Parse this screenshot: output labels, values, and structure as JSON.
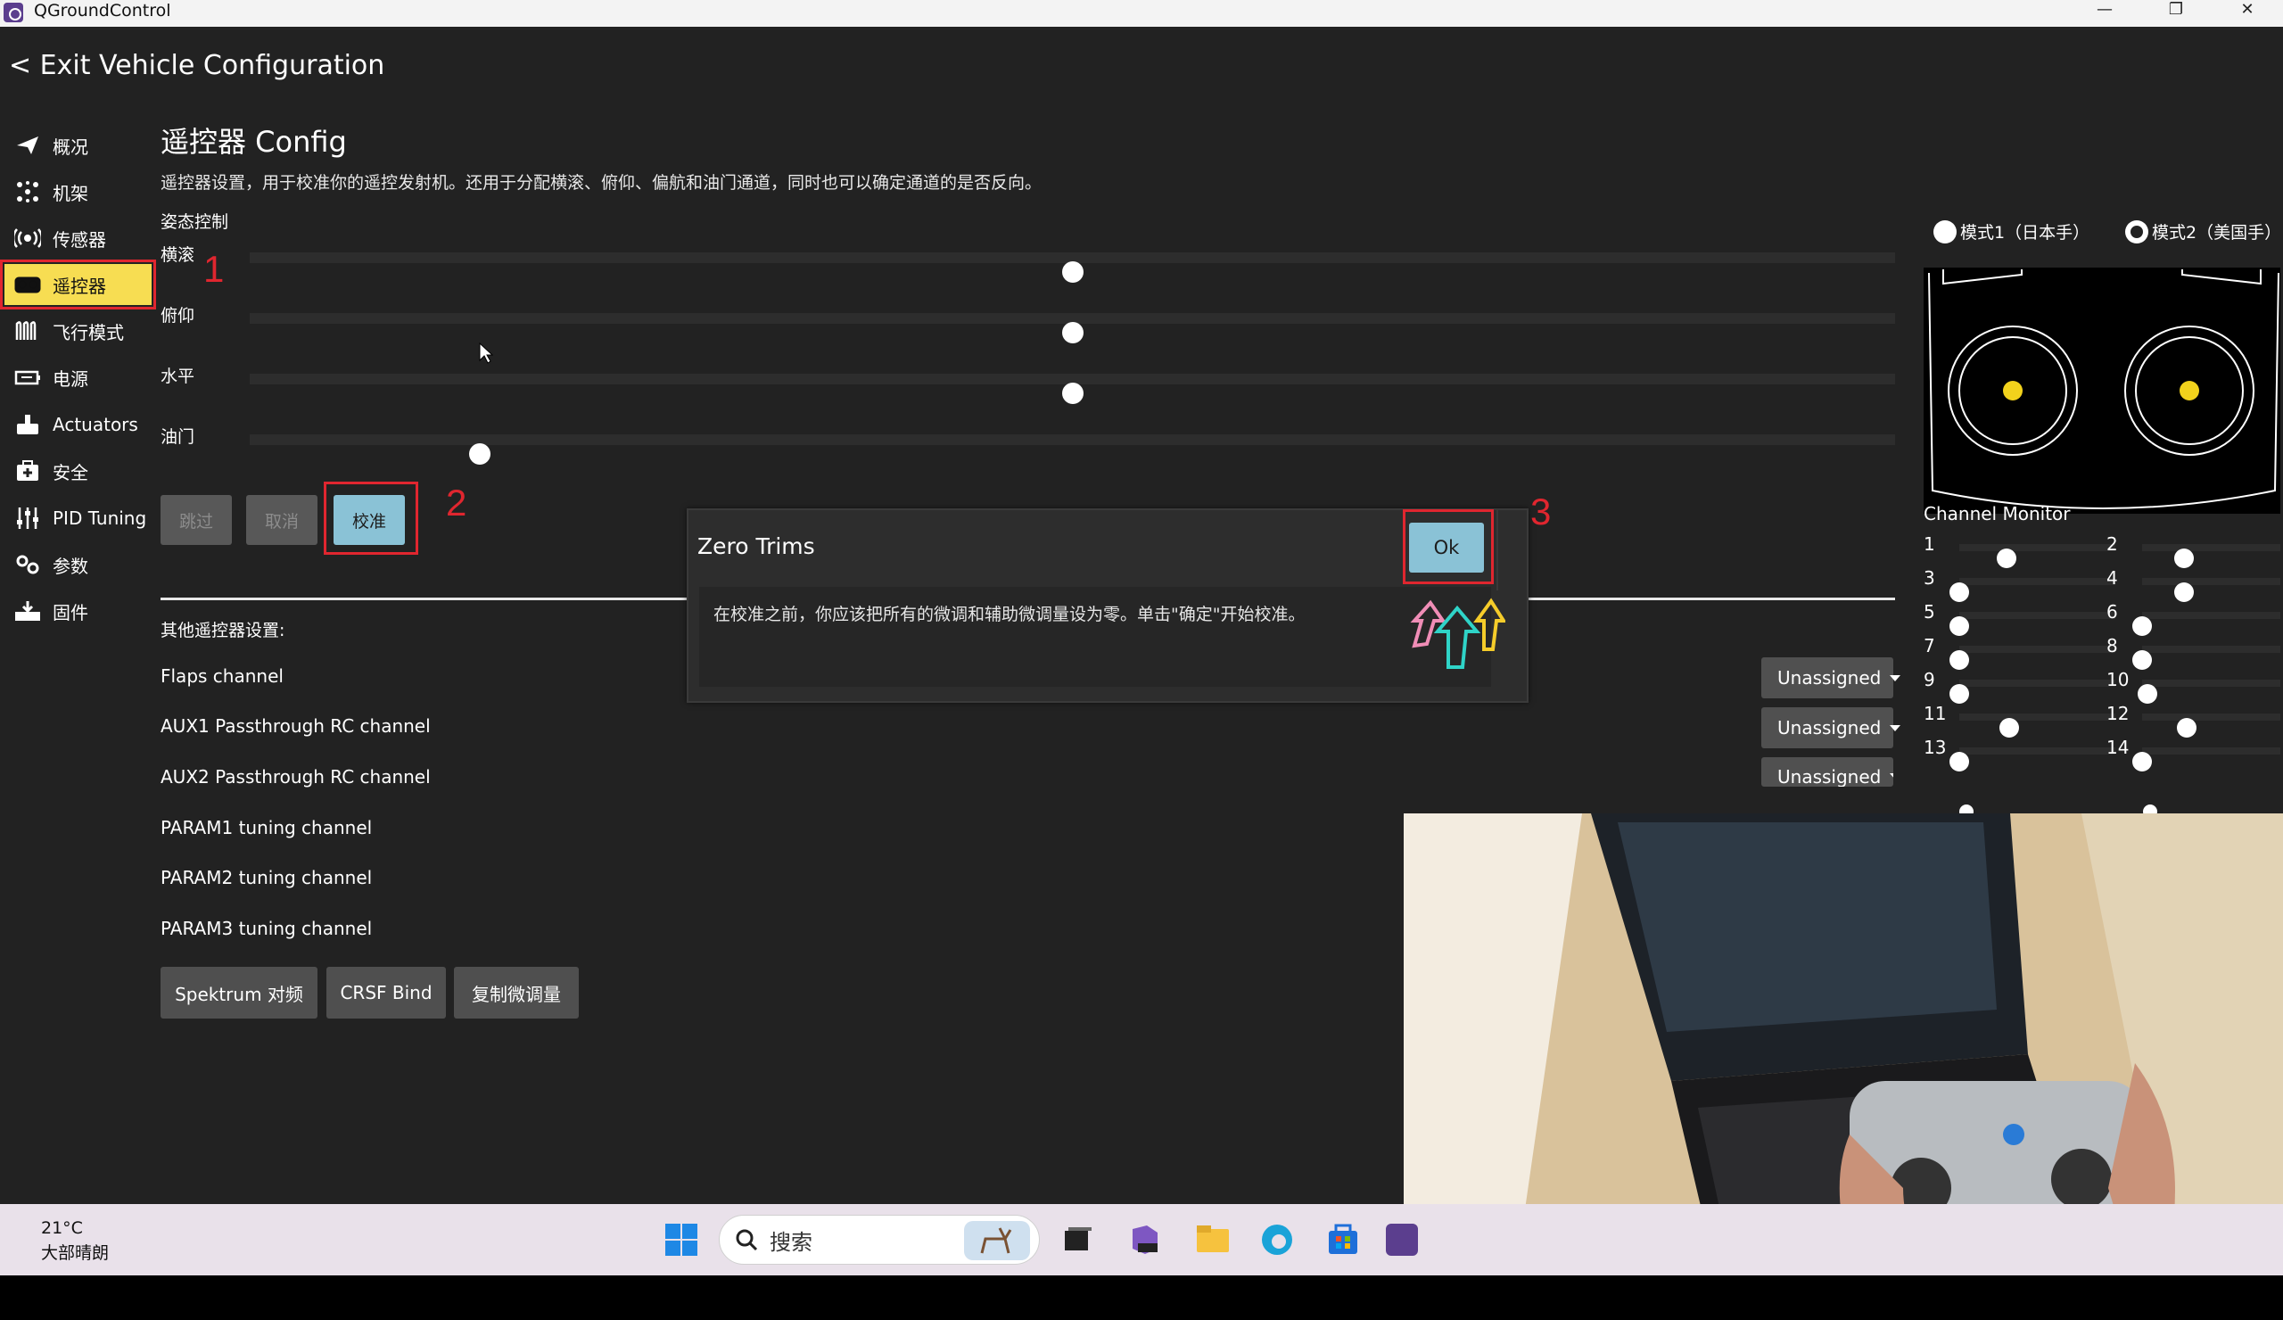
{
  "window": {
    "title": "QGroundControl"
  },
  "header": {
    "exit_label": "< Exit Vehicle Configuration"
  },
  "sidebar": {
    "items": [
      {
        "label": "概况",
        "icon": "paper-plane-icon"
      },
      {
        "label": "机架",
        "icon": "airframe-icon"
      },
      {
        "label": "传感器",
        "icon": "sensors-icon"
      },
      {
        "label": "遥控器",
        "icon": "radio-controller-icon",
        "active": true
      },
      {
        "label": "飞行模式",
        "icon": "flight-modes-icon"
      },
      {
        "label": "电源",
        "icon": "battery-icon"
      },
      {
        "label": "Actuators",
        "icon": "actuators-icon"
      },
      {
        "label": "安全",
        "icon": "safety-icon"
      },
      {
        "label": "PID Tuning",
        "icon": "pid-sliders-icon"
      },
      {
        "label": "参数",
        "icon": "parameters-icon"
      },
      {
        "label": "固件",
        "icon": "firmware-icon"
      }
    ]
  },
  "main": {
    "title": "遥控器 Config",
    "description": "遥控器设置，用于校准你的遥控发射机。还用于分配横滚、俯仰、偏航和油门通道，同时也可以确定通道的是否反向。",
    "attitude_label": "姿态控制",
    "sliders": [
      {
        "label": "横滚",
        "value": 0.5
      },
      {
        "label": "俯仰",
        "value": 0.5
      },
      {
        "label": "水平",
        "value": 0.5
      },
      {
        "label": "油门",
        "value": 0.14
      }
    ],
    "buttons": {
      "skip": "跳过",
      "cancel": "取消",
      "calibrate": "校准"
    },
    "annotations": {
      "one": "1",
      "two": "2",
      "three": "3"
    },
    "other_label": "其他遥控器设置:",
    "settings": [
      {
        "label": "Flaps channel",
        "dropdown": "Unassigned"
      },
      {
        "label": "AUX1 Passthrough RC channel",
        "dropdown": "Unassigned"
      },
      {
        "label": "AUX2 Passthrough RC channel",
        "dropdown": "Unassigned"
      },
      {
        "label": "PARAM1 tuning channel"
      },
      {
        "label": "PARAM2 tuning channel"
      },
      {
        "label": "PARAM3 tuning channel"
      }
    ],
    "bottom_buttons": {
      "spektrum": "Spektrum 对频",
      "crsf": "CRSF Bind",
      "copy_trims": "复制微调量"
    }
  },
  "dialog": {
    "title": "Zero Trims",
    "ok_label": "Ok",
    "body": "在校准之前，你应该把所有的微调和辅助微调量设为零。单击\"确定\"开始校准。"
  },
  "right_panel": {
    "mode1_label": "模式1（日本手）",
    "mode2_label": "模式2（美国手）",
    "selected_mode": 2,
    "channel_monitor_title": "Channel Monitor",
    "channels": [
      {
        "num": "1",
        "value": 0.3
      },
      {
        "num": "2",
        "value": 0.3
      },
      {
        "num": "3",
        "value": 0.0
      },
      {
        "num": "4",
        "value": 0.3
      },
      {
        "num": "5",
        "value": 0.0
      },
      {
        "num": "6",
        "value": 0.0
      },
      {
        "num": "7",
        "value": 0.0
      },
      {
        "num": "8",
        "value": 0.0
      },
      {
        "num": "9",
        "value": 0.0
      },
      {
        "num": "10",
        "value": 0.04
      },
      {
        "num": "11",
        "value": 0.32
      },
      {
        "num": "12",
        "value": 0.32
      },
      {
        "num": "13",
        "value": 0.0
      },
      {
        "num": "14",
        "value": 0.0
      }
    ]
  },
  "taskbar": {
    "temperature": "21°C",
    "weather": "大部晴朗",
    "search_placeholder": "搜索"
  },
  "colors": {
    "background": "#222222",
    "active_nav": "#f7dd52",
    "accent_button": "#8ac2d6",
    "annotation_red": "#e0262f",
    "stick_dot": "#f2d21c"
  }
}
